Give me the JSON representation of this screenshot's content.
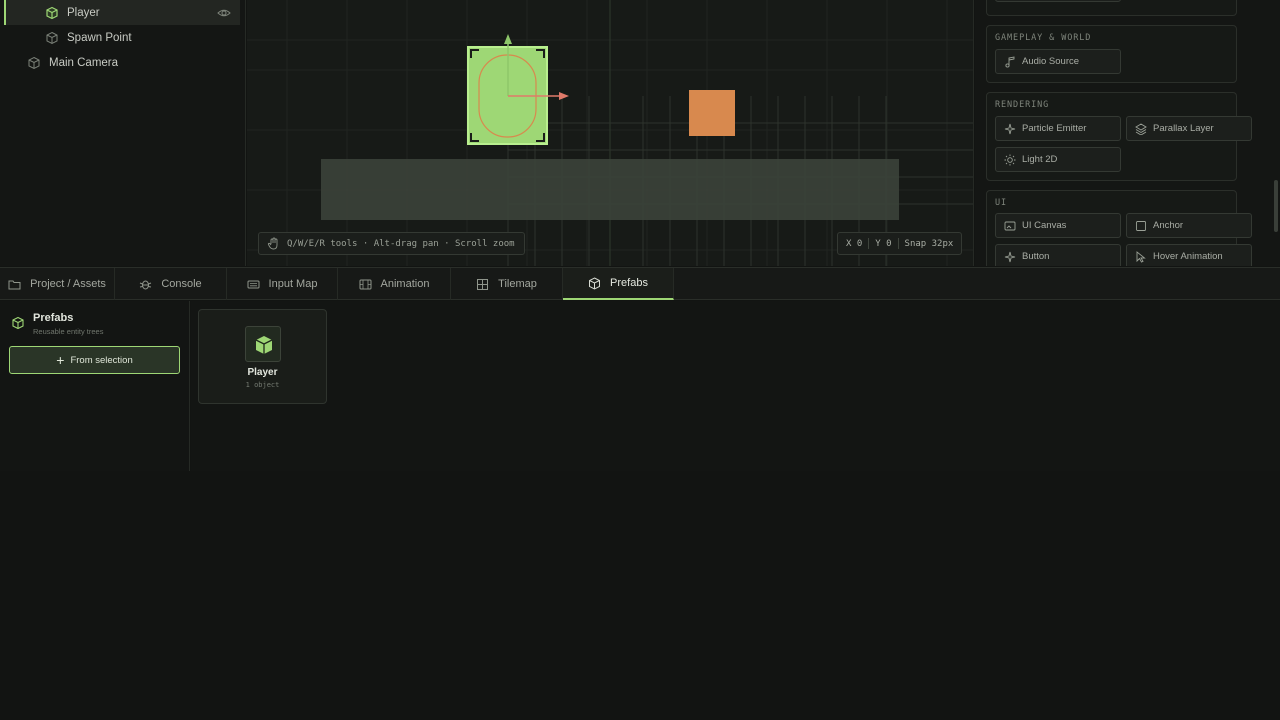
{
  "hierarchy": {
    "items": [
      {
        "label": "Player"
      },
      {
        "label": "Spawn Point"
      },
      {
        "label": "Main Camera"
      }
    ]
  },
  "viewport": {
    "hint": "Q/W/E/R tools · Alt-drag pan · Scroll zoom",
    "x_label": "X 0",
    "y_label": "Y 0",
    "snap_label": "Snap 32px"
  },
  "library": {
    "groups": [
      {
        "title": "GAMEPLAY & WORLD",
        "items": [
          {
            "label": "Audio Source",
            "icon": "music-note-icon"
          }
        ]
      },
      {
        "title": "RENDERING",
        "items": [
          {
            "label": "Particle Emitter",
            "icon": "sparkle-icon"
          },
          {
            "label": "Parallax Layer",
            "icon": "layers-icon"
          },
          {
            "label": "Light 2D",
            "icon": "sun-icon"
          }
        ]
      },
      {
        "title": "UI",
        "items": [
          {
            "label": "UI Canvas",
            "icon": "canvas-icon"
          },
          {
            "label": "Anchor",
            "icon": "square-icon"
          },
          {
            "label": "Button",
            "icon": "pointer-icon"
          },
          {
            "label": "Hover Animation",
            "icon": "cursor-icon"
          }
        ]
      }
    ]
  },
  "tabs": [
    {
      "label": "Project / Assets",
      "icon": "folder-icon"
    },
    {
      "label": "Console",
      "icon": "bug-icon"
    },
    {
      "label": "Input Map",
      "icon": "keyboard-icon"
    },
    {
      "label": "Animation",
      "icon": "film-icon"
    },
    {
      "label": "Tilemap",
      "icon": "grid-icon"
    },
    {
      "label": "Prefabs",
      "icon": "cube-icon",
      "active": true
    }
  ],
  "prefabs": {
    "title": "Prefabs",
    "subtitle": "Reusable entity trees",
    "from_selection": "From selection",
    "cards": [
      {
        "name": "Player",
        "count": "1 object"
      }
    ]
  },
  "colors": {
    "accent": "#9ed775",
    "crate": "#d8894e",
    "player_fill": "#9ed775"
  }
}
